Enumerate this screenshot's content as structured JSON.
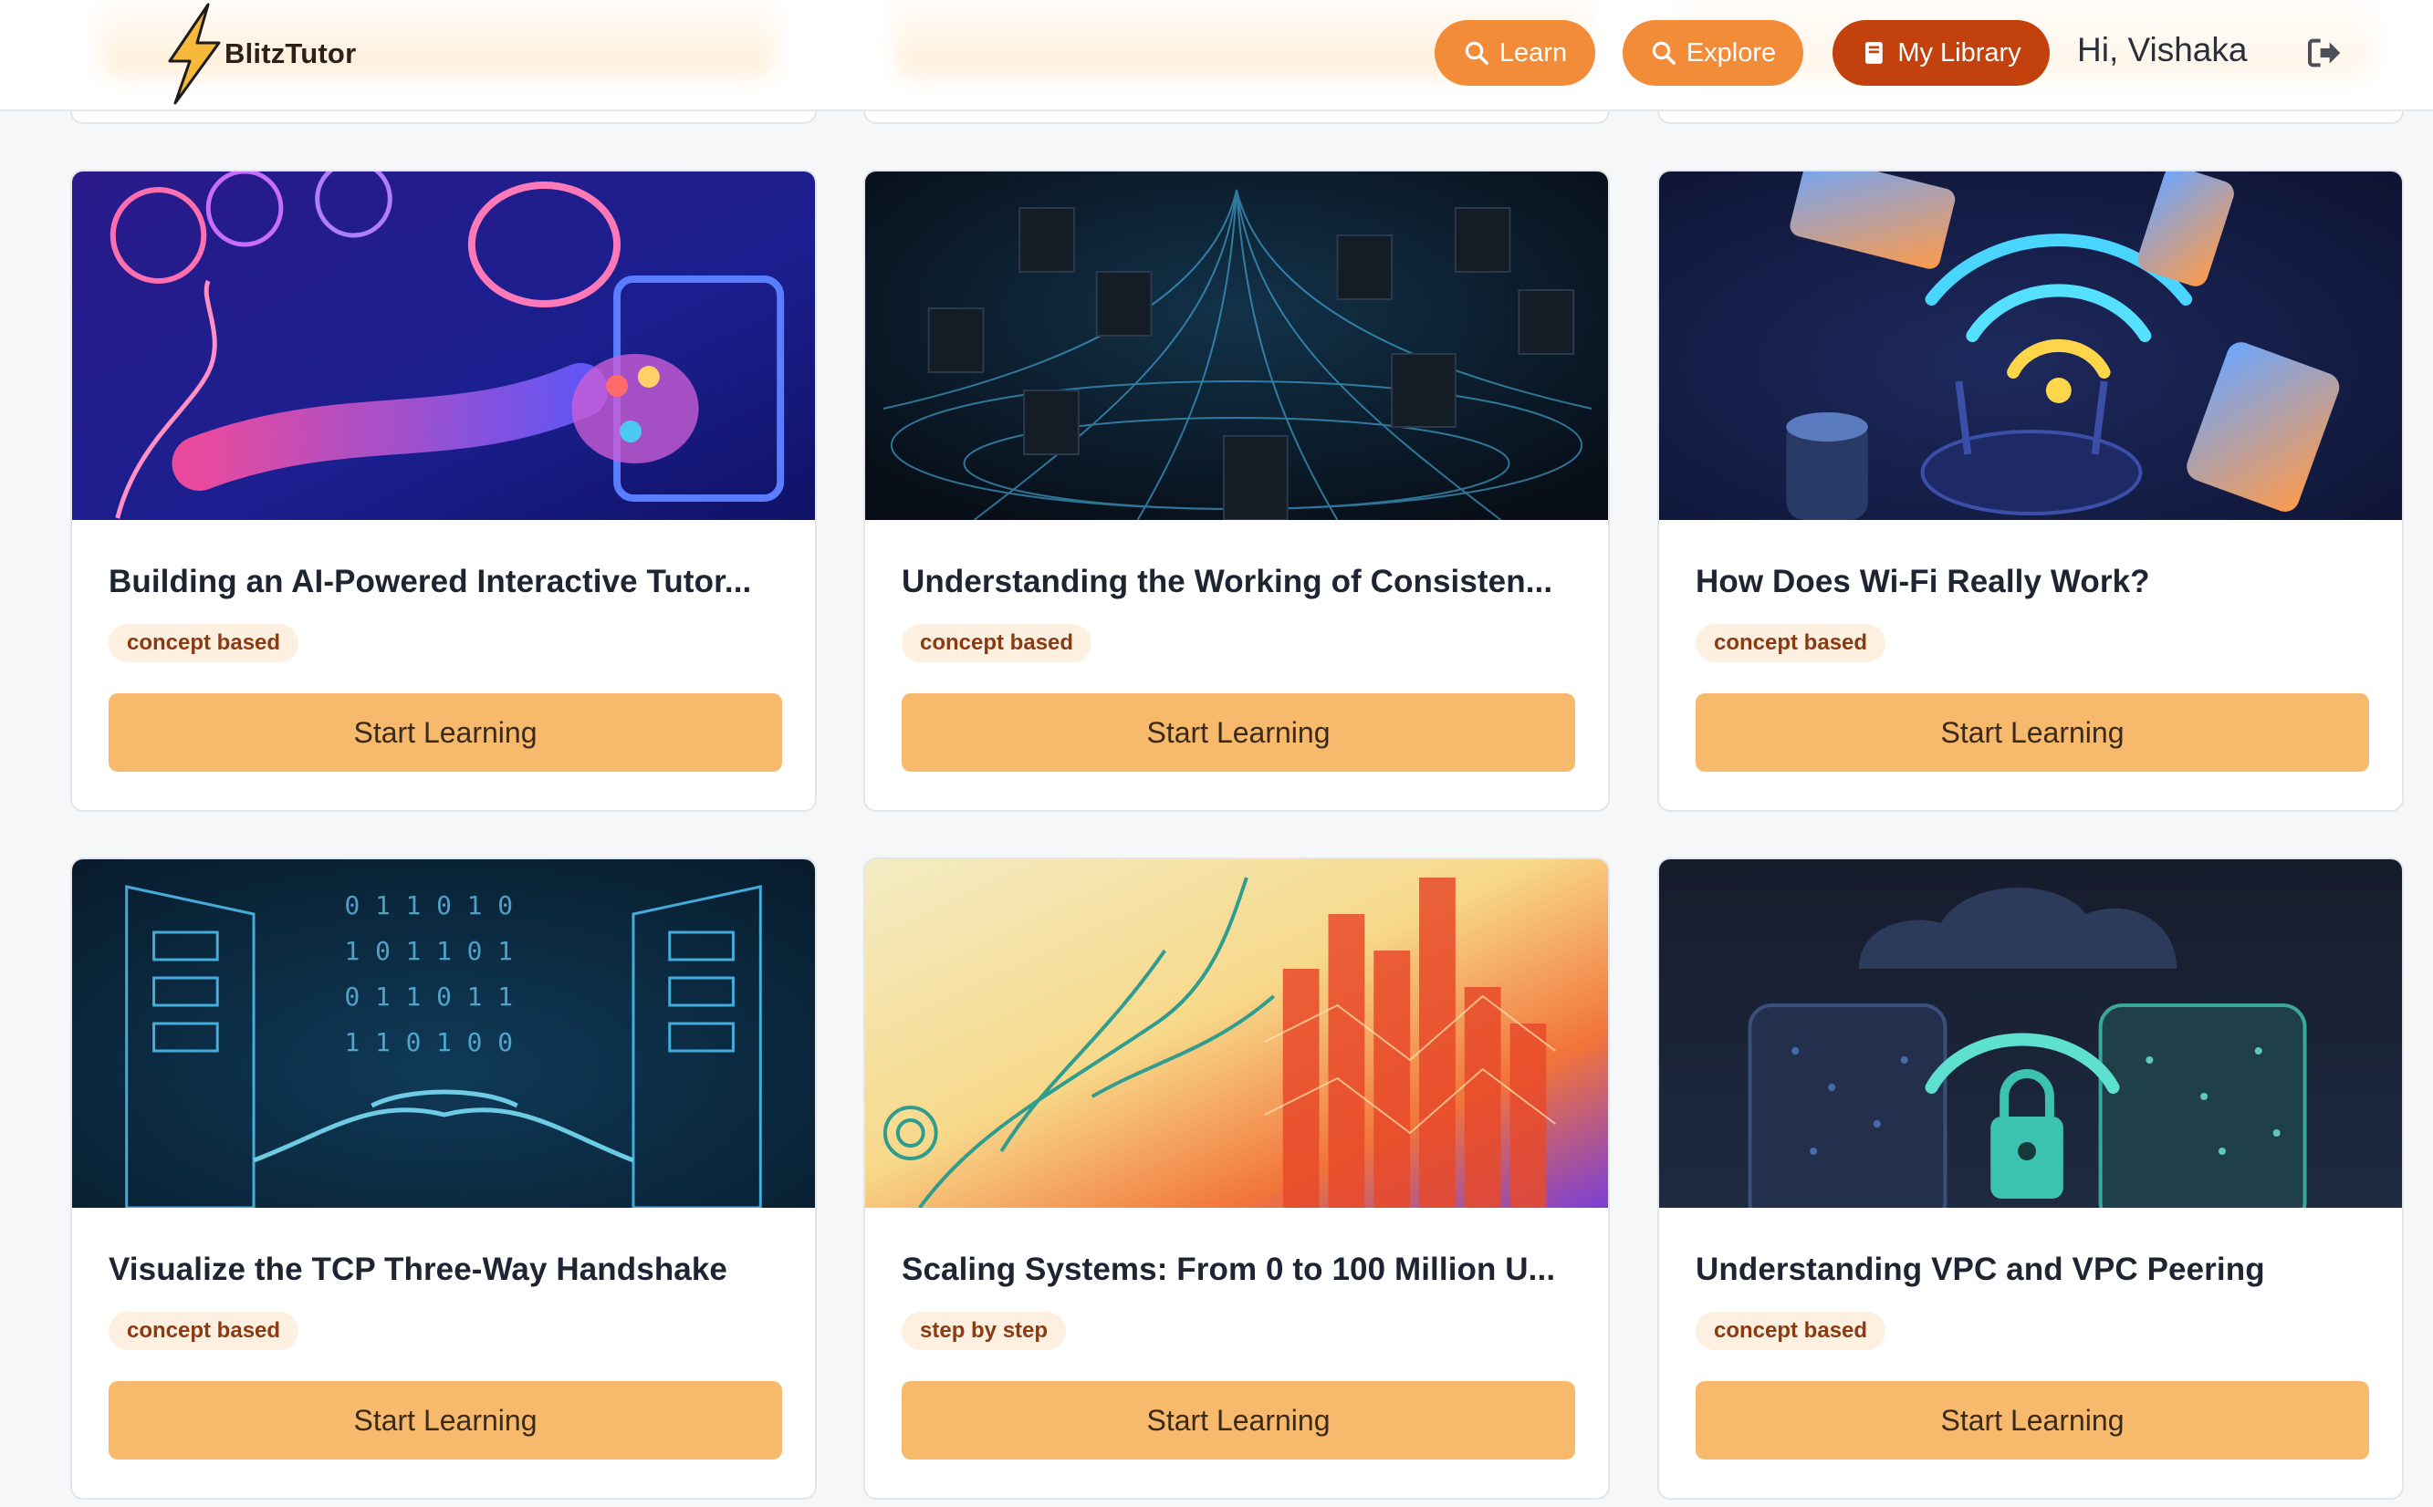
{
  "header": {
    "brand": "BlitzTutor",
    "nav": [
      {
        "label": "Learn",
        "icon": "search-icon",
        "color": "#f28c38"
      },
      {
        "label": "Explore",
        "icon": "search-icon",
        "color": "#f28c38"
      },
      {
        "label": "My Library",
        "icon": "book-icon",
        "color": "#c2410c"
      }
    ],
    "greeting": "Hi, Vishaka",
    "logout_icon": "logout-icon"
  },
  "cards": [
    {
      "title": "Building an AI-Powered Interactive Tutor...",
      "tag": "concept based",
      "button": "Start Learning"
    },
    {
      "title": "Understanding the Working of Consisten...",
      "tag": "concept based",
      "button": "Start Learning"
    },
    {
      "title": "How Does Wi-Fi Really Work?",
      "tag": "concept based",
      "button": "Start Learning"
    },
    {
      "title": "Visualize the TCP Three-Way Handshake",
      "tag": "concept based",
      "button": "Start Learning"
    },
    {
      "title": "Scaling Systems: From 0 to 100 Million U...",
      "tag": "step by step",
      "button": "Start Learning"
    },
    {
      "title": "Understanding VPC and VPC Peering",
      "tag": "concept based",
      "button": "Start Learning"
    }
  ],
  "colors": {
    "accent": "#f7b96b",
    "tag_bg": "#fdf0e0",
    "tag_text": "#8a3b12"
  }
}
